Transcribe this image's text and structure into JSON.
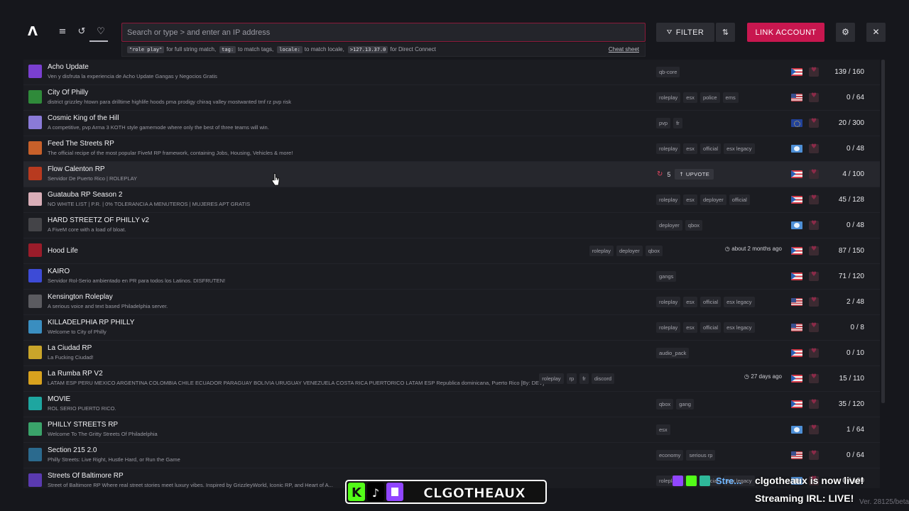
{
  "app": {
    "logo_glyph": "Λ"
  },
  "nav": {
    "menu_glyph": "≡",
    "history_glyph": "↺",
    "favorites_glyph": "♡"
  },
  "search": {
    "placeholder": "Search or type > and enter an IP address",
    "hints": [
      {
        "code": "\"role play\"",
        "text": "for full string match,"
      },
      {
        "code": "tag:",
        "text": "to match tags,"
      },
      {
        "code": "locale:",
        "text": "to match locale,"
      },
      {
        "code": ">127.13.37.0",
        "text": "for Direct Connect"
      }
    ],
    "cheat_sheet": "Cheat sheet"
  },
  "toolbar": {
    "filter_label": "FILTER",
    "filter_glyph": "⛛",
    "sort_glyph": "⇅",
    "link_account_label": "LINK ACCOUNT",
    "settings_glyph": "⚙",
    "close_glyph": "✕"
  },
  "servers": [
    {
      "name": "Acho Update",
      "desc": "Ven y disfruta la experiencia de Acho Update Gangas y Negocios Gratis",
      "tags": [
        "qb-core"
      ],
      "flag": "pr",
      "players": "139 / 160",
      "icon_color": "#7a3fd0"
    },
    {
      "name": "City Of Philly",
      "desc": "district grizzley htown para drilltime highlife hoods pma prodigy chiraq valley mostwanted tmf rz pvp risk",
      "tags": [
        "roleplay",
        "esx",
        "police",
        "ems"
      ],
      "flag": "us",
      "players": "0 / 64",
      "icon_color": "#2f8a3a"
    },
    {
      "name": "Cosmic King of the Hill",
      "desc": "A competitive, pvp Arma 3 KOTH style gamemode where only the best of three teams will win.",
      "tags": [
        "pvp",
        "fr"
      ],
      "flag": "eu",
      "players": "20 / 300",
      "icon_color": "#8a7ad8"
    },
    {
      "name": "Feed The Streets RP",
      "desc": "The official recipe of the most popular FiveM RP framework, containing Jobs, Housing, Vehicles & more!",
      "tags": [
        "roleplay",
        "esx",
        "official",
        "esx legacy"
      ],
      "flag": "world",
      "players": "0 / 48",
      "icon_color": "#c7602a"
    },
    {
      "name": "Flow Calenton RP",
      "desc": "Servidor De Puerto Rico | ROLEPLAY",
      "tags": [],
      "flag": "pr",
      "players": "4 / 100",
      "icon_color": "#b83a1f",
      "boost": {
        "count": "5",
        "upvote": "UPVOTE"
      }
    },
    {
      "name": "Guatauba RP Season 2",
      "desc": "NO WHITE LIST  |  P.R.  |  0% TOLERANCIA A MENUTEROS  |  MUJERES APT GRATIS",
      "tags": [
        "roleplay",
        "esx",
        "deployer",
        "official"
      ],
      "flag": "pr",
      "players": "45 / 128",
      "icon_color": "#d9aeb8"
    },
    {
      "name": "HARD STREETZ OF PHILLY v2",
      "desc": "A FiveM core with a load of bloat.",
      "tags": [
        "deployer",
        "qbox"
      ],
      "flag": "world",
      "players": "0 / 48",
      "icon_color": "#444448"
    },
    {
      "name": "Hood Life",
      "desc": "",
      "tags": [
        "roleplay",
        "deployer",
        "qbox"
      ],
      "flag": "pr",
      "players": "87 / 150",
      "icon_color": "#9a1c2a",
      "ago": "about 2 months ago"
    },
    {
      "name": "KAIRO",
      "desc": "Servidor Rol-Serio ambientado en PR para todos los Latinos. DISFRUTEN!",
      "tags": [
        "gangs"
      ],
      "flag": "pr",
      "players": "71 / 120",
      "icon_color": "#3d4bd6"
    },
    {
      "name": "Kensington Roleplay",
      "desc": "A serious voice and text based Philadelphia server.",
      "tags": [
        "roleplay",
        "esx",
        "official",
        "esx legacy"
      ],
      "flag": "us",
      "players": "2 / 48",
      "icon_color": "#5b5b60"
    },
    {
      "name": "KILLADELPHIA RP PHILLY",
      "desc": "Welcome to City of Philly",
      "tags": [
        "roleplay",
        "esx",
        "official",
        "esx legacy"
      ],
      "flag": "us",
      "players": "0 / 8",
      "icon_color": "#3a8ec0"
    },
    {
      "name": "La Ciudad RP",
      "desc": "La Fucking Ciudad!",
      "tags": [
        "audio_pack"
      ],
      "flag": "pr",
      "players": "0 / 10",
      "icon_color": "#c9a52a"
    },
    {
      "name": "La Rumba RP V2",
      "desc": "LATAM ESP PERU MEXICO ARGENTINA COLOMBIA CHILE ECUADOR PARAGUAY BOLIVIA URUGUAY VENEZUELA COSTA RICA PUERTORICO LATAM ESP Republica dominicana, Puerto Rico [By: DEV]",
      "tags": [
        "roleplay",
        "rp",
        "fr",
        "discord"
      ],
      "flag": "pr",
      "players": "15 / 110",
      "icon_color": "#d8a21e",
      "ago": "27 days ago"
    },
    {
      "name": "MOVIE",
      "desc": "ROL SERIO PUERTO RICO.",
      "tags": [
        "qbox",
        "gang"
      ],
      "flag": "pr",
      "players": "35 / 120",
      "icon_color": "#1ea6a0"
    },
    {
      "name": "PHILLY STREETS RP",
      "desc": "Welcome To The Gritty Streets Of Philadelphia",
      "tags": [
        "esx"
      ],
      "flag": "world",
      "players": "1 / 64",
      "icon_color": "#3aa36a"
    },
    {
      "name": "Section 215 2.0",
      "desc": "Philly Streets: Live Right, Hustle Hard, or Run the Game",
      "tags": [
        "economy",
        "serious rp"
      ],
      "flag": "us",
      "players": "0 / 64",
      "icon_color": "#2b6a8e"
    },
    {
      "name": "Streets Of Baltimore RP",
      "desc": "Street of Baltimore RP Where real street stories meet luxury vibes. Inspired by GrizzleyWorld, Iconic RP, and Heart of A...",
      "tags": [
        "roleplay",
        "esx",
        "official",
        "esx legacy"
      ],
      "flag": "world",
      "players": "0 / 100",
      "icon_color": "#5a3ab0"
    }
  ],
  "overlay": {
    "streamer_name": "CLGOTHEAUX",
    "live_line1": "clgotheaux is now live!",
    "live_line2": "Streaming IRL: LIVE!",
    "mini_text": "Stre...",
    "version": "Ver. 28125/beta"
  }
}
